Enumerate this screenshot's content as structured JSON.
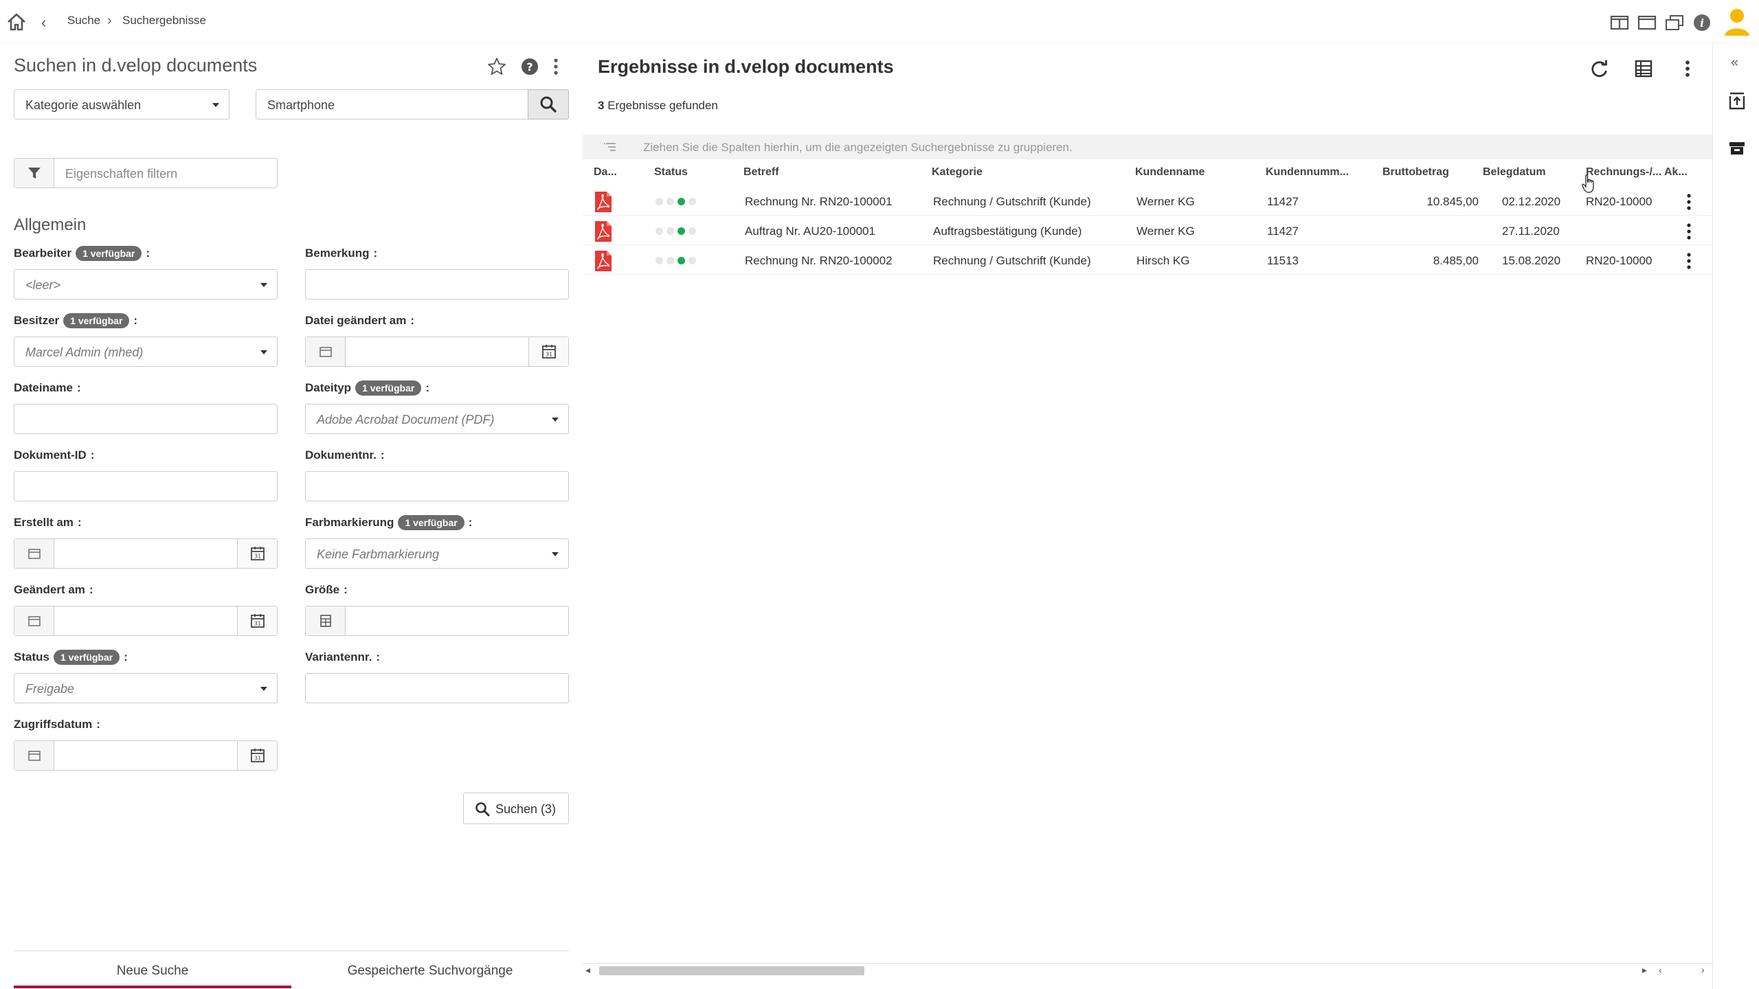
{
  "topbar": {
    "breadcrumb": [
      "Suche",
      "Suchergebnisse"
    ]
  },
  "search_panel": {
    "title": "Suchen in d.velop documents",
    "category_select": "Kategorie auswählen",
    "search_input": "Smartphone",
    "filter_placeholder": "Eigenschaften filtern",
    "section_title": "Allgemein",
    "fields": {
      "bearbeiter": {
        "label": "Bearbeiter",
        "badge": "1 verfügbar",
        "value": "<leer>"
      },
      "bemerkung": {
        "label": "Bemerkung"
      },
      "besitzer": {
        "label": "Besitzer",
        "badge": "1 verfügbar",
        "value": "Marcel Admin (mhed)"
      },
      "datei_geaendert": {
        "label": "Datei geändert am"
      },
      "dateiname": {
        "label": "Dateiname"
      },
      "dateityp": {
        "label": "Dateityp",
        "badge": "1 verfügbar",
        "value": "Adobe Acrobat Document (PDF)"
      },
      "dokument_id": {
        "label": "Dokument-ID"
      },
      "dokumentnr": {
        "label": "Dokumentnr."
      },
      "erstellt_am": {
        "label": "Erstellt am"
      },
      "farbmarkierung": {
        "label": "Farbmarkierung",
        "badge": "1 verfügbar",
        "value": "Keine Farbmarkierung"
      },
      "geaendert_am": {
        "label": "Geändert am"
      },
      "groesse": {
        "label": "Größe"
      },
      "status": {
        "label": "Status",
        "badge": "1 verfügbar",
        "value": "Freigabe"
      },
      "variantennr": {
        "label": "Variantennr."
      },
      "zugriffsdatum": {
        "label": "Zugriffsdatum"
      }
    },
    "colon": ":",
    "search_button": "Suchen (3)",
    "tabs": [
      "Neue Suche",
      "Gespeicherte Suchvorgänge"
    ]
  },
  "results": {
    "title": "Ergebnisse in d.velop documents",
    "count": "3",
    "count_label": "Ergebnisse gefunden",
    "grouping_hint": "Ziehen Sie die Spalten hierhin, um die angezeigten Suchergebnisse zu gruppieren.",
    "columns": [
      "Da...",
      "Status",
      "Betreff",
      "Kategorie",
      "Kundenname",
      "Kundennumm...",
      "Bruttobetrag",
      "Belegdatum",
      "Rechnungs-/...",
      "Ak..."
    ],
    "rows": [
      {
        "status_level": 3,
        "betreff": "Rechnung Nr. RN20-100001",
        "kategorie": "Rechnung / Gutschrift (Kunde)",
        "kundenname": "Werner KG",
        "kundennummer": "11427",
        "brutto": "10.845,00",
        "belegdatum": "02.12.2020",
        "rechnung": "RN20-10000"
      },
      {
        "status_level": 3,
        "betreff": "Auftrag Nr. AU20-100001",
        "kategorie": "Auftragsbestätigung (Kunde)",
        "kundenname": "Werner KG",
        "kundennummer": "11427",
        "brutto": "",
        "belegdatum": "27.11.2020",
        "rechnung": ""
      },
      {
        "status_level": 3,
        "betreff": "Rechnung Nr. RN20-100002",
        "kategorie": "Rechnung / Gutschrift (Kunde)",
        "kundenname": "Hirsch KG",
        "kundennummer": "11513",
        "brutto": "8.485,00",
        "belegdatum": "15.08.2020",
        "rechnung": "RN20-10000"
      }
    ]
  },
  "colors": {
    "accent": "#a4123f",
    "status_green": "#1aaa55",
    "pdf_red": "#e53935",
    "avatar_yellow": "#f6b800"
  }
}
